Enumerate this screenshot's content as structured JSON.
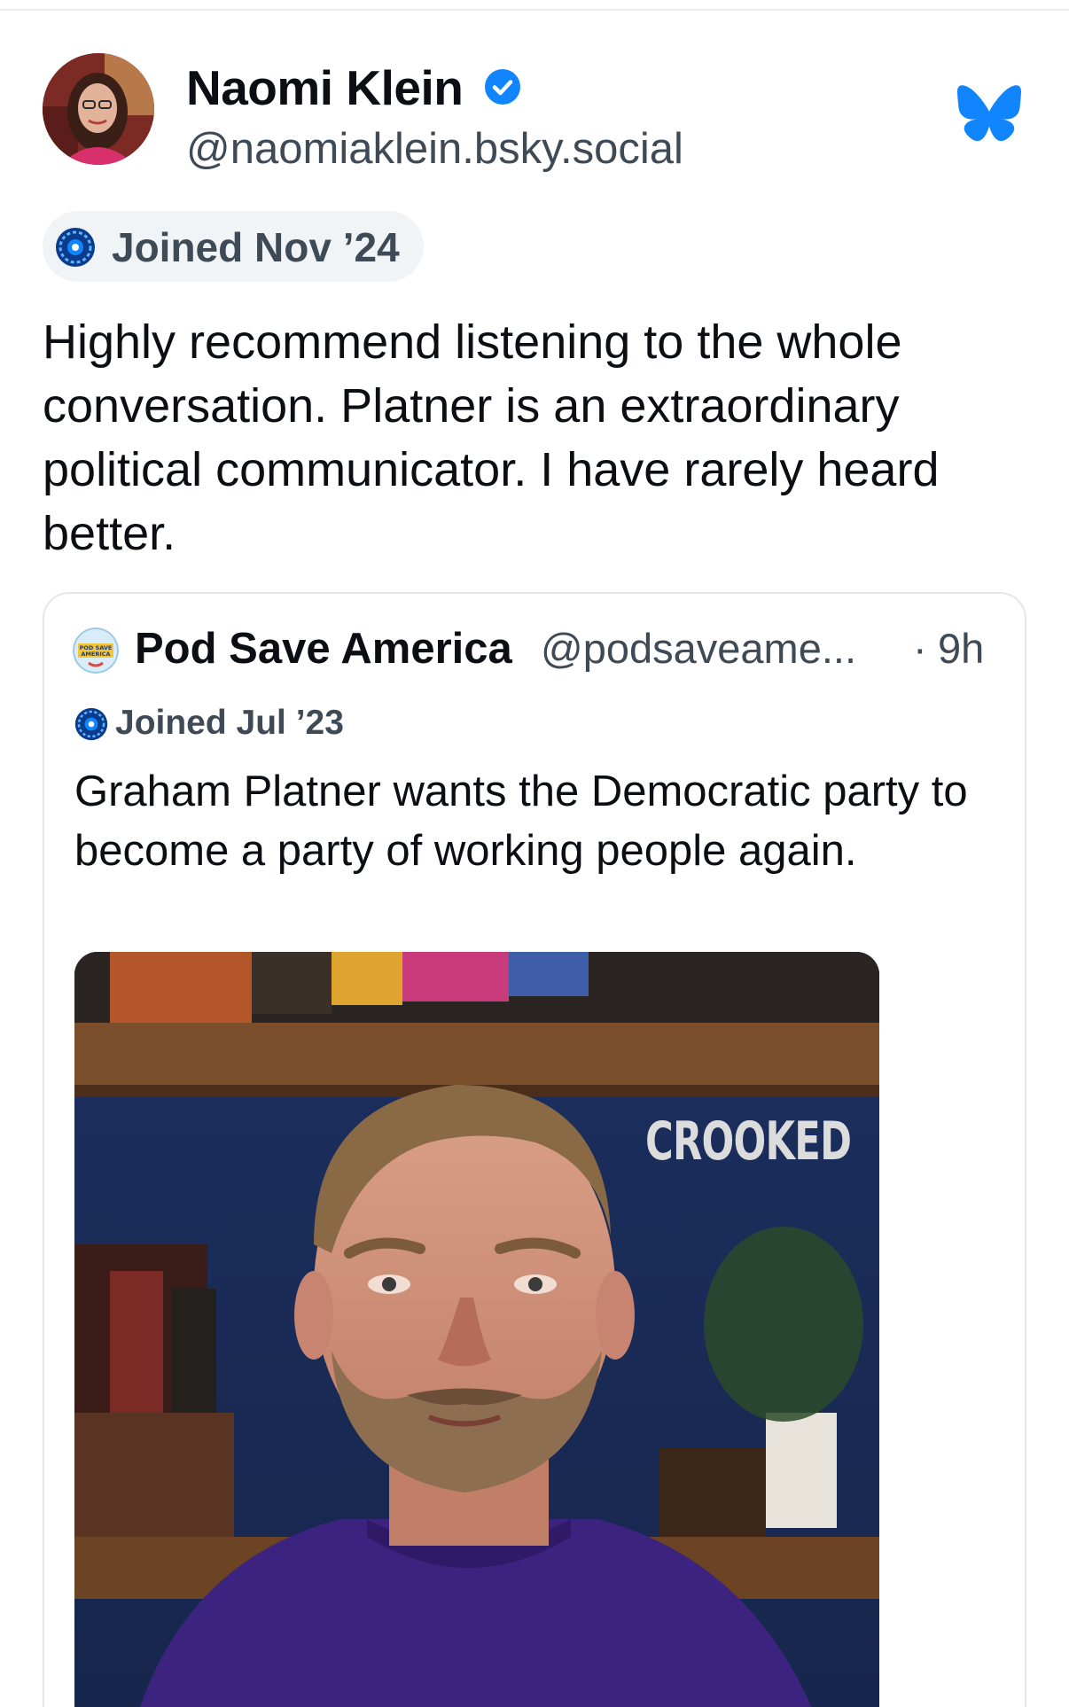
{
  "post": {
    "author": {
      "display_name": "Naomi Klein",
      "handle": "@naomiaklein.bsky.social",
      "verified": true,
      "joined": "Joined Nov ’24"
    },
    "text": "Highly recommend listening to the whole conversation. Platner is an extraordinary political communicator. I have rarely heard better."
  },
  "quote": {
    "author": {
      "display_name": "Pod Save America",
      "handle": "@podsaveame...",
      "time_separator": "·",
      "time": "9h",
      "joined": "Joined Jul ’23"
    },
    "text": "Graham Platner wants the Democratic party to become a party of working people again.",
    "media": {
      "type": "video",
      "watermark": "CROOKED"
    },
    "avatar_text": "POD SAVE AMERICA"
  },
  "icons": {
    "verified": "verified-check-icon",
    "platform": "bluesky-butterfly-icon",
    "joined": "new-account-badge-icon"
  },
  "colors": {
    "accent": "#1185fe",
    "text": "#0b0f14",
    "muted": "#3f4a57",
    "pill_bg": "#f1f4f7",
    "border": "#e3e7eb"
  }
}
